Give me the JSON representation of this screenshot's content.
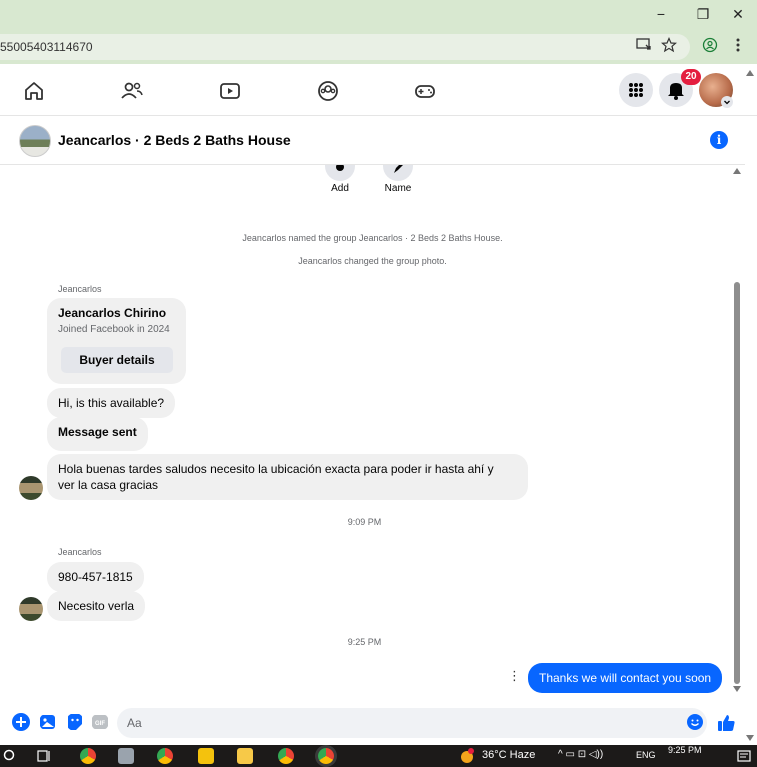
{
  "browser": {
    "url": "55005403114670",
    "minimize": "−",
    "restore": "❐",
    "close": "✕"
  },
  "fbnav": {
    "notifications_count": "20"
  },
  "chat": {
    "title": "Jeancarlos · 2 Beds 2 Baths House",
    "actions": [
      {
        "label": "Add"
      },
      {
        "label": "Name"
      }
    ],
    "system_messages": [
      "Jeancarlos named the group Jeancarlos · 2 Beds 2 Baths House.",
      "Jeancarlos changed the group photo."
    ],
    "sender_name": "Jeancarlos",
    "profile_card": {
      "name": "Jeancarlos Chirino",
      "subtitle": "Joined Facebook in 2024",
      "button": "Buyer details"
    },
    "messages": [
      "Hi, is this available?",
      "Message sent",
      "Hola buenas tardes saludos  necesito  la ubicación exacta para poder ir hasta ahí y",
      "ver la casa gracias",
      "980-457-1815",
      "Necesito  verla",
      "Thanks we will contact you soon"
    ],
    "timestamps": [
      "9:09 PM",
      "9:25 PM"
    ],
    "more_label": "⋮"
  },
  "composer": {
    "placeholder": "Aa"
  },
  "taskbar": {
    "weather": "36°C  Haze",
    "language": "ENG",
    "clock": "9:25 PM"
  }
}
